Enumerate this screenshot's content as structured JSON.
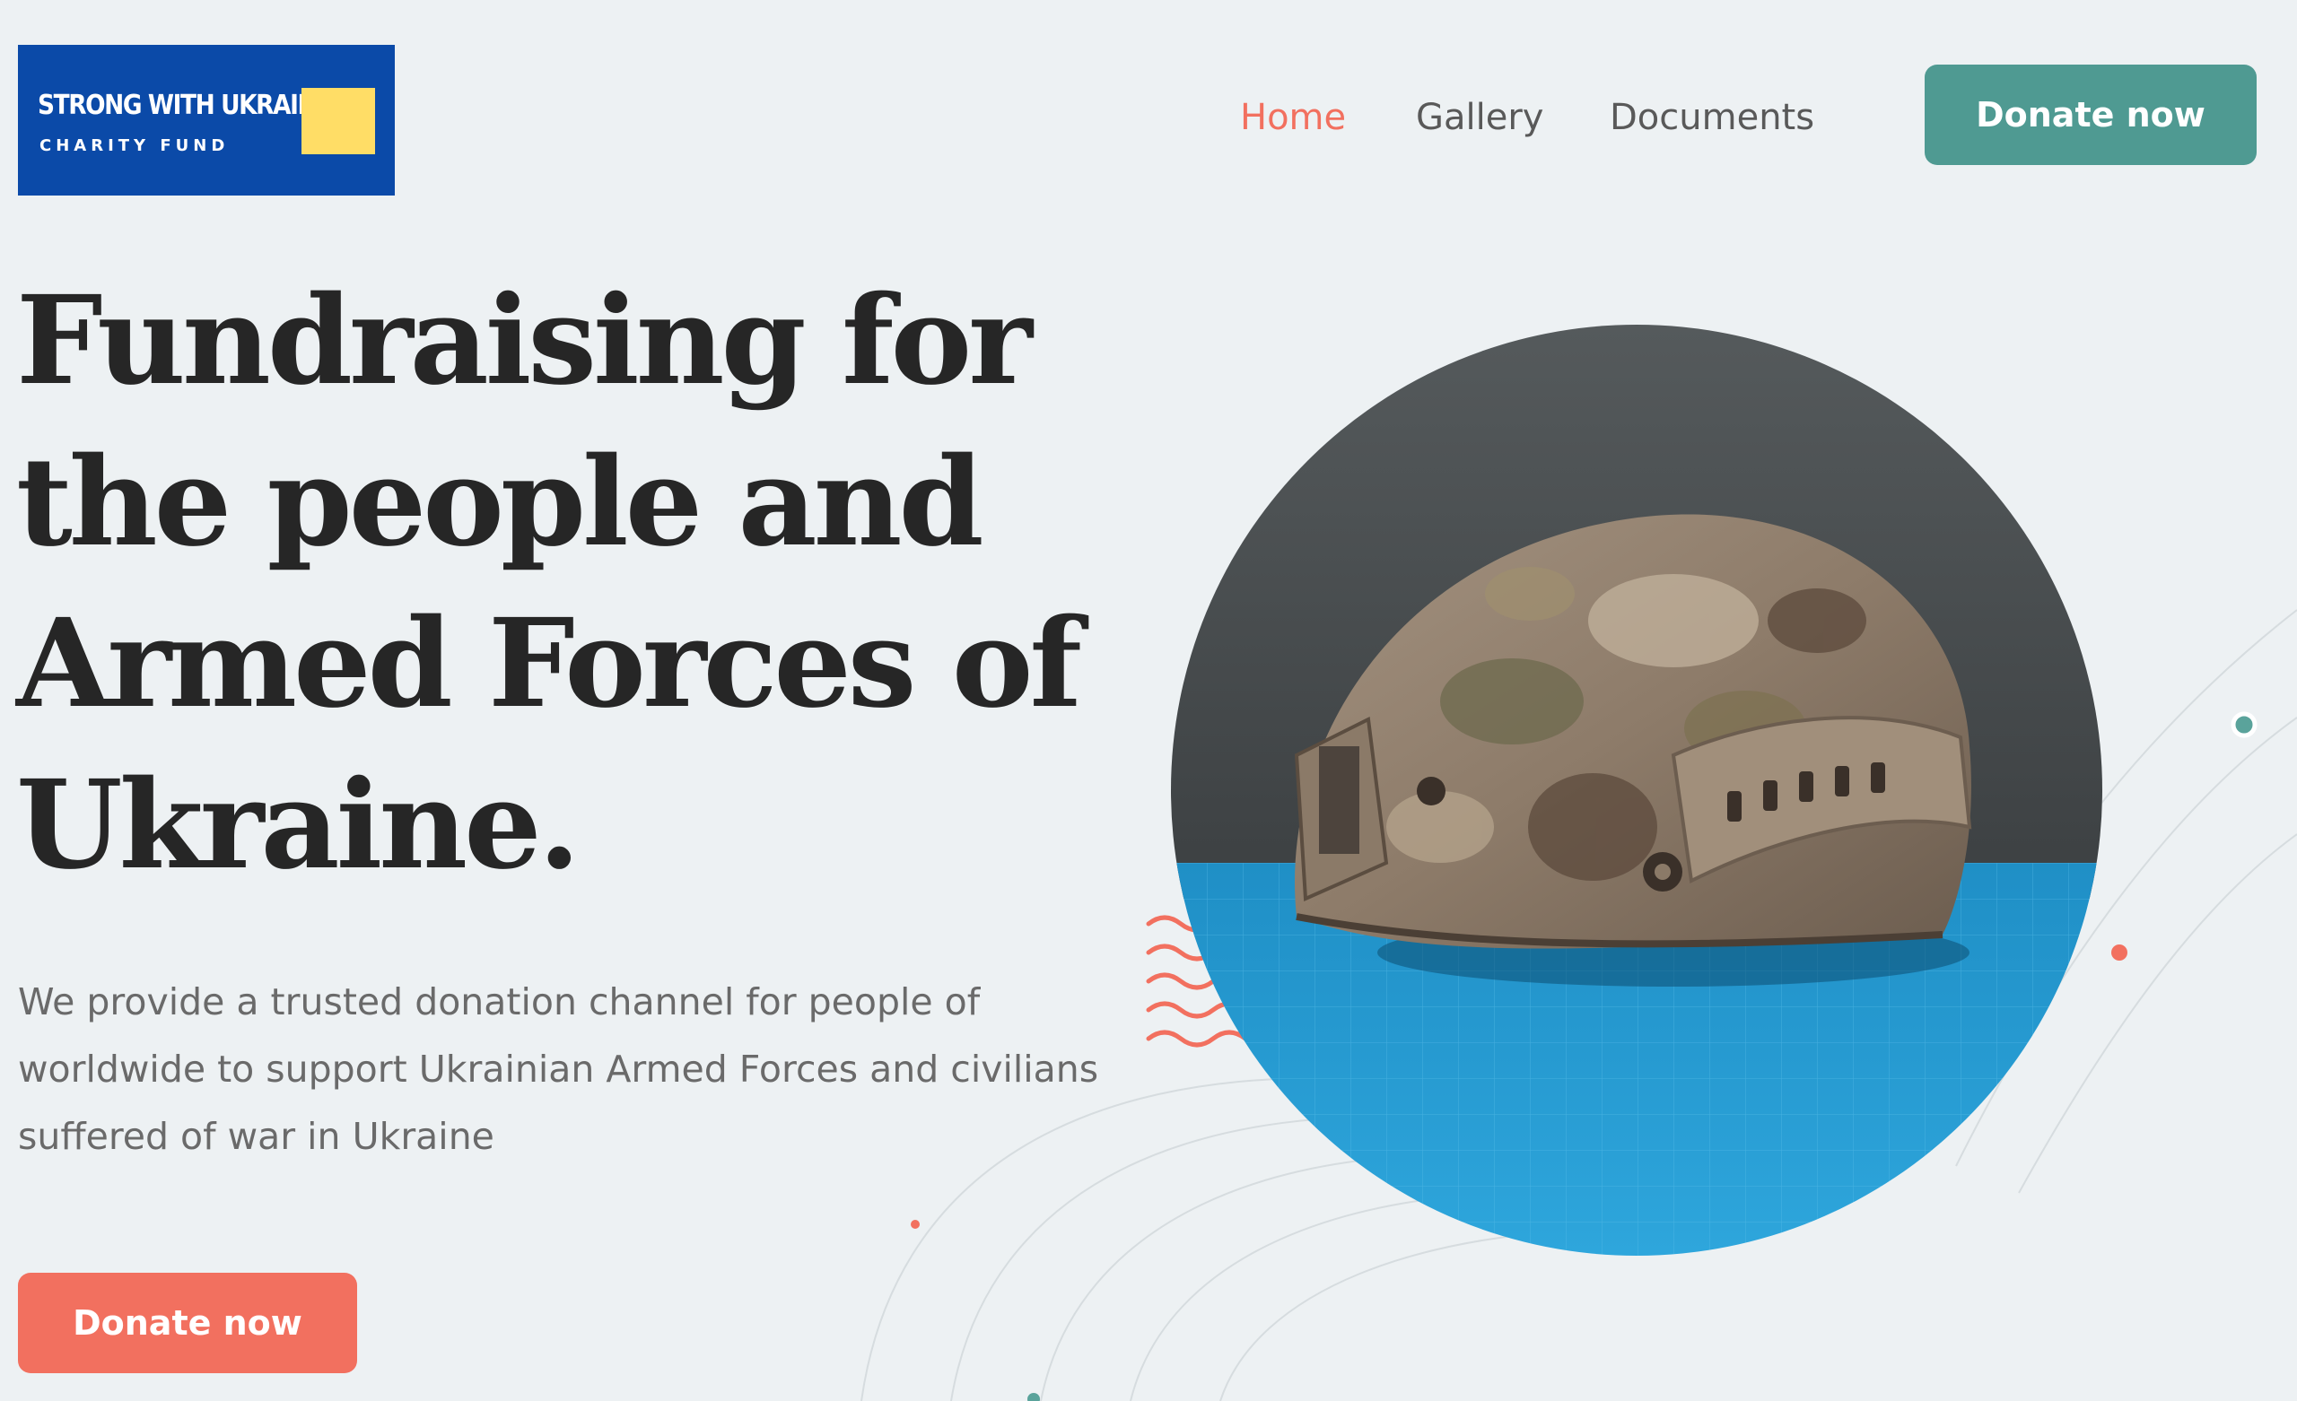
{
  "logo": {
    "title": "STRONG WITH UKRAINE",
    "subtitle": "CHARITY FUND"
  },
  "nav": {
    "items": [
      {
        "label": "Home",
        "active": true
      },
      {
        "label": "Gallery",
        "active": false
      },
      {
        "label": "Documents",
        "active": false
      }
    ]
  },
  "header": {
    "donate_label": "Donate now"
  },
  "hero": {
    "title_lines": [
      "Fundraising for",
      "the people and",
      "Armed Forces of",
      "Ukraine."
    ],
    "description": "We provide a trusted donation channel for people of worldwide to support Ukrainian Armed Forces and civilians suffered of war in Ukraine",
    "donate_label": "Donate now",
    "image": "military-helmet-photo"
  },
  "colors": {
    "background": "#edf1f3",
    "accent_coral": "#f2705f",
    "accent_teal": "#4f9a92",
    "logo_blue": "#0b4aa8",
    "logo_yellow": "#ffdd66",
    "heading": "#262626",
    "body_text": "#6a6a6a"
  }
}
